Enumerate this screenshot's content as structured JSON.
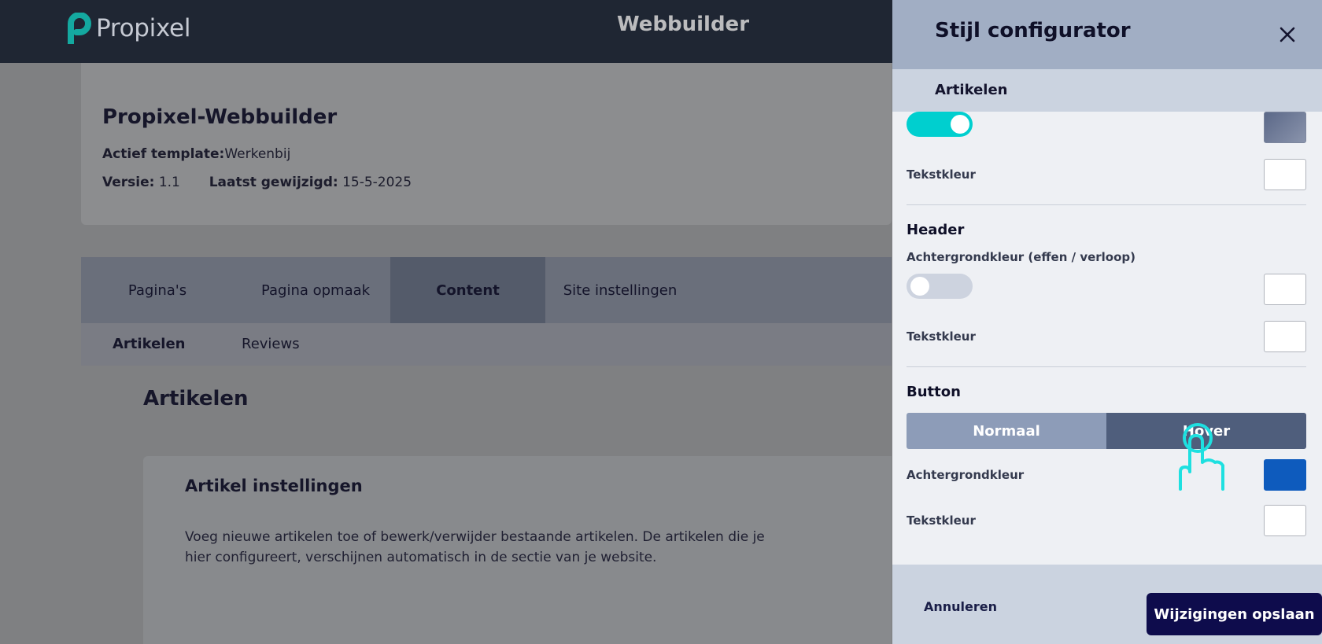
{
  "topbar": {
    "logo_text": "Propixel",
    "app_title": "Webbuilder"
  },
  "info": {
    "title": "Propixel-Webbuilder",
    "template_label": "Actief template:",
    "template_value": "Werkenbij",
    "version_label": "Versie:",
    "version_value": "1.1",
    "modified_label": "Laatst gewijzigd:",
    "modified_value": "15-5-2025"
  },
  "tabs": [
    {
      "label": "Pagina's"
    },
    {
      "label": "Pagina opmaak"
    },
    {
      "label": "Content",
      "active": true
    },
    {
      "label": "Site instellingen"
    }
  ],
  "subtabs": [
    {
      "label": "Artikelen",
      "active": true
    },
    {
      "label": "Reviews"
    }
  ],
  "main": {
    "section_title": "Artikelen",
    "card_title": "Artikel instellingen",
    "card_text": "Voeg nieuwe artikelen toe of bewerk/verwijder bestaande artikelen. De artikelen die je hier configureert, verschijnen automatisch in de sectie van je website."
  },
  "panel": {
    "title": "Stijl configurator",
    "close_icon": "close-icon",
    "subtitle": "Artikelen",
    "top_toggle_on": true,
    "top_swatch_color": "#6f7b97",
    "top_textcolor_label": "Tekstkleur",
    "top_textcolor": "#ffffff",
    "header": {
      "heading": "Header",
      "bg_label": "Achtergrondkleur (effen / verloop)",
      "gradient_toggle_on": false,
      "bg_color": "#ffffff",
      "textcolor_label": "Tekstkleur",
      "textcolor": "#ffffff"
    },
    "button": {
      "heading": "Button",
      "state_normal": "Normaal",
      "state_hover": "Hover",
      "active_state": "Hover",
      "bg_label": "Achtergrondkleur",
      "bg_color": "#0e5bbd",
      "textcolor_label": "Tekstkleur",
      "textcolor": "#ffffff"
    },
    "cancel_label": "Annuleren",
    "save_label": "Wijzigingen opslaan"
  },
  "colors": {
    "accent_teal": "#00cfcf",
    "primary_dark": "#0e0c4c",
    "topbar": "#1f2633"
  }
}
